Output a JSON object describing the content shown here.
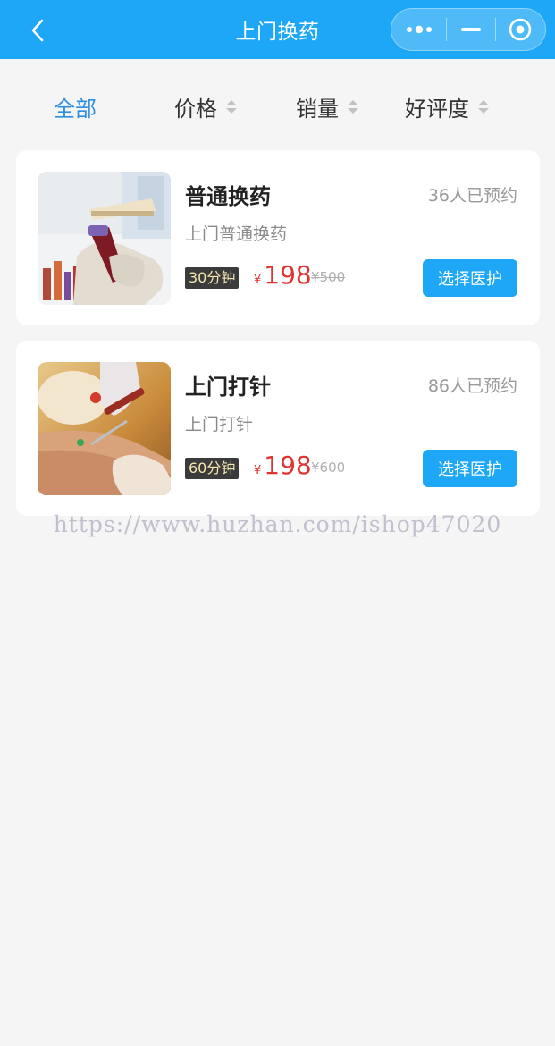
{
  "header": {
    "title": "上门换药",
    "background": "#1ea7f6"
  },
  "filters": [
    {
      "label": "全部",
      "active": true,
      "sortable": false
    },
    {
      "label": "价格",
      "active": false,
      "sortable": true
    },
    {
      "label": "销量",
      "active": false,
      "sortable": true
    },
    {
      "label": "好评度",
      "active": false,
      "sortable": true
    }
  ],
  "services": [
    {
      "name": "普通换药",
      "booked": "36人已预约",
      "subtitle": "上门普通换药",
      "duration": "30分钟",
      "currency": "¥",
      "price": "198",
      "original_price": "¥500",
      "button": "选择医护",
      "image": "blood-sample-tubes-glove-photo"
    },
    {
      "name": "上门打针",
      "booked": "86人已预约",
      "subtitle": "上门打针",
      "duration": "60分钟",
      "currency": "¥",
      "price": "198",
      "original_price": "¥600",
      "button": "选择医护",
      "image": "injection-in-arm-photo"
    }
  ],
  "watermark": "https://www.huzhan.com/ishop47020",
  "colors": {
    "accent": "#1ea7f6",
    "active_filter": "#2e8fe0",
    "price": "#e0332f"
  }
}
